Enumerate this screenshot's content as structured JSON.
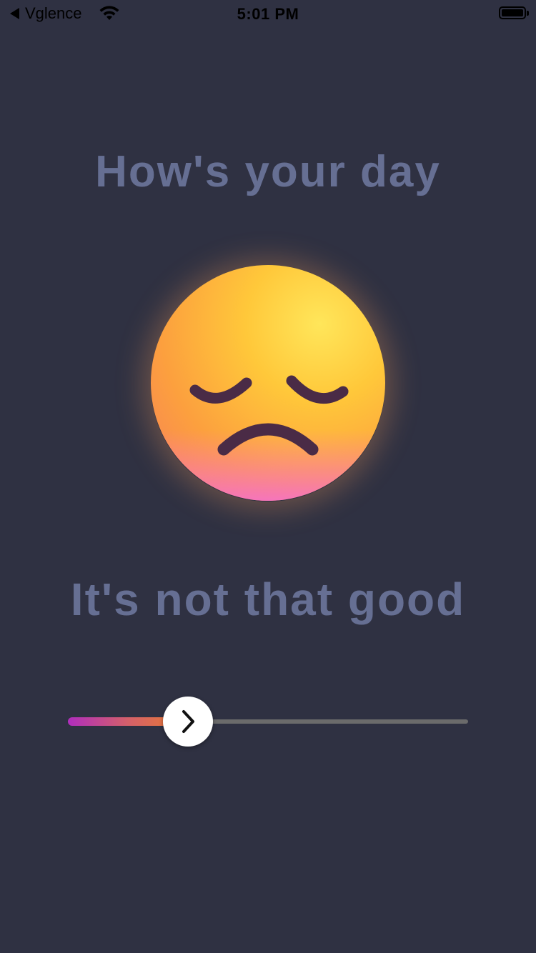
{
  "status_bar": {
    "back_app": "Vglence",
    "time": "5:01 PM",
    "icons": [
      "back-arrow-icon",
      "wifi-icon",
      "battery-icon"
    ]
  },
  "screen": {
    "title": "How's your day",
    "emoji": "pensive-sad-face",
    "mood_label": "It's not that good"
  },
  "mood_slider": {
    "value_fraction": 0.3,
    "thumb_icon": "chevron-right-icon",
    "gradient_colors": [
      "#b02dbd",
      "#ea7d2c"
    ],
    "track_color": "#6b6b6b"
  },
  "colors": {
    "background": "#2f3142",
    "text": "#666f93"
  }
}
